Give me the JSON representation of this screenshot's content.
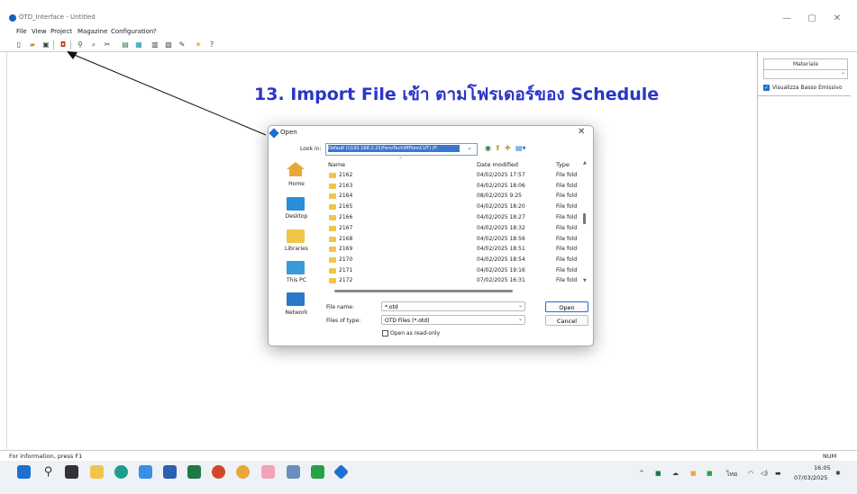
{
  "window": {
    "title": "OTD_Interface - Untitled",
    "controls": {
      "minimize": "—",
      "maximize": "▢",
      "close": "✕"
    }
  },
  "menubar": [
    "File",
    "View",
    "Project",
    "Magazine",
    "Configuration",
    "?"
  ],
  "toolbar": {
    "icons": [
      "new-file-icon",
      "open-folder-icon",
      "save-icon",
      "import-file-icon",
      "zoom-in-icon",
      "zoom-out-icon",
      "cut-icon",
      "database-icon",
      "layers-icon",
      "grid-icon",
      "table-icon",
      "edit-icon",
      "run-icon",
      "help-icon"
    ]
  },
  "annotation": {
    "text": "13. Import File เข้า ตามโฟรเดอร์ของ Schedule",
    "color": "#2a35c9"
  },
  "right_panel": {
    "header": "Materiale",
    "checkbox_label": "Visualizza Basso Emissivo",
    "checkbox_checked": true
  },
  "dialog": {
    "title": "Open",
    "look_in_label": "Look in:",
    "look_in_value": "Default (\\\\192.168.2.21\\FenoTech\\MFiles\\CUT) (F:",
    "places": [
      "Home",
      "Desktop",
      "Libraries",
      "This PC",
      "Network"
    ],
    "columns": {
      "name": "Name",
      "date": "Date modified",
      "type": "Type"
    },
    "rows": [
      {
        "name": "2162",
        "date": "04/02/2025 17:57",
        "type": "File fold"
      },
      {
        "name": "2163",
        "date": "04/02/2025 18:06",
        "type": "File fold"
      },
      {
        "name": "2164",
        "date": "08/02/2025 9:25",
        "type": "File fold"
      },
      {
        "name": "2165",
        "date": "04/02/2025 18:20",
        "type": "File fold"
      },
      {
        "name": "2166",
        "date": "04/02/2025 18:27",
        "type": "File fold"
      },
      {
        "name": "2167",
        "date": "04/02/2025 18:32",
        "type": "File fold"
      },
      {
        "name": "2168",
        "date": "04/02/2025 18:56",
        "type": "File fold"
      },
      {
        "name": "2169",
        "date": "04/02/2025 18:51",
        "type": "File fold"
      },
      {
        "name": "2170",
        "date": "04/02/2025 18:54",
        "type": "File fold"
      },
      {
        "name": "2171",
        "date": "04/02/2025 19:16",
        "type": "File fold"
      },
      {
        "name": "2172",
        "date": "07/02/2025 16:31",
        "type": "File fold"
      }
    ],
    "file_name_label": "File name:",
    "file_name_value": "*.otd",
    "file_type_label": "Files of type:",
    "file_type_value": "OTD Files (*.otd)",
    "read_only_label": "Open as read-only",
    "open_button": "Open",
    "cancel_button": "Cancel"
  },
  "statusbar": {
    "text": "For information, press F1",
    "num": "NUM"
  },
  "taskbar": {
    "time": "16:05",
    "date": "07/03/2025",
    "language": "ไทย"
  }
}
